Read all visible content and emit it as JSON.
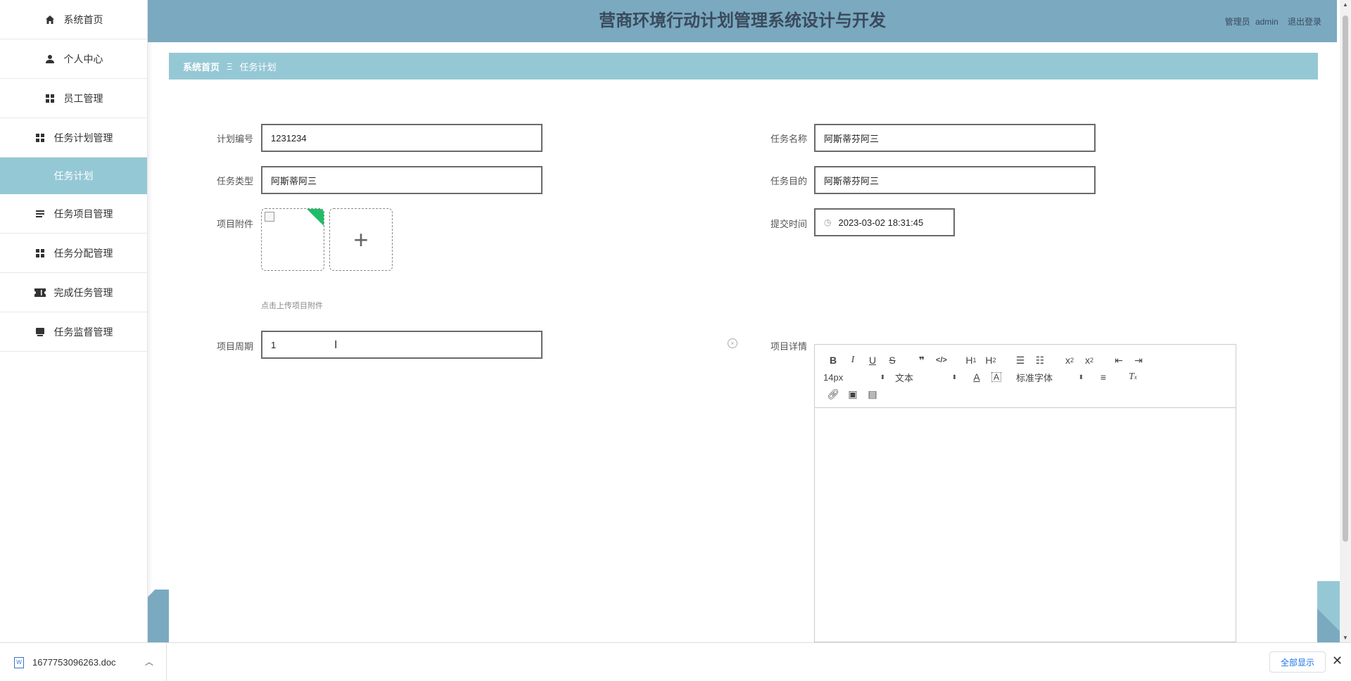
{
  "header": {
    "title": "营商环境行动计划管理系统设计与开发",
    "role": "管理员",
    "username": "admin",
    "logout": "退出登录"
  },
  "sidebar": {
    "items": [
      {
        "label": "系统首页",
        "icon": "home-icon"
      },
      {
        "label": "个人中心",
        "icon": "user-icon"
      },
      {
        "label": "员工管理",
        "icon": "grid-icon"
      },
      {
        "label": "任务计划管理",
        "icon": "grid-icon"
      },
      {
        "label": "任务计划",
        "icon": ""
      },
      {
        "label": "任务项目管理",
        "icon": "list-icon"
      },
      {
        "label": "任务分配管理",
        "icon": "grid-icon"
      },
      {
        "label": "完成任务管理",
        "icon": "ticket-icon"
      },
      {
        "label": "任务监督管理",
        "icon": "monitor-icon"
      }
    ]
  },
  "breadcrumb": {
    "home": "系统首页",
    "separator": "Ξ",
    "current": "任务计划"
  },
  "form": {
    "plan_no_label": "计划编号",
    "plan_no_value": "1231234",
    "task_name_label": "任务名称",
    "task_name_value": "阿斯蒂芬阿三",
    "task_type_label": "任务类型",
    "task_type_value": "阿斯蒂阿三",
    "task_goal_label": "任务目的",
    "task_goal_value": "阿斯蒂芬阿三",
    "attachment_label": "项目附件",
    "attachment_tip": "点击上传项目附件",
    "submit_time_label": "提交时间",
    "submit_time_value": "2023-03-02 18:31:45",
    "cycle_label": "项目周期",
    "cycle_value": "1",
    "detail_label": "项目详情"
  },
  "editor": {
    "font_size": "14px",
    "block_type": "文本",
    "font_family": "标准字体"
  },
  "downloads": {
    "file_name": "1677753096263.doc",
    "show_all": "全部显示"
  },
  "colors": {
    "header_bg": "#7aa9c0",
    "accent": "#95c8d5",
    "upload_badge": "#1fbd67"
  }
}
